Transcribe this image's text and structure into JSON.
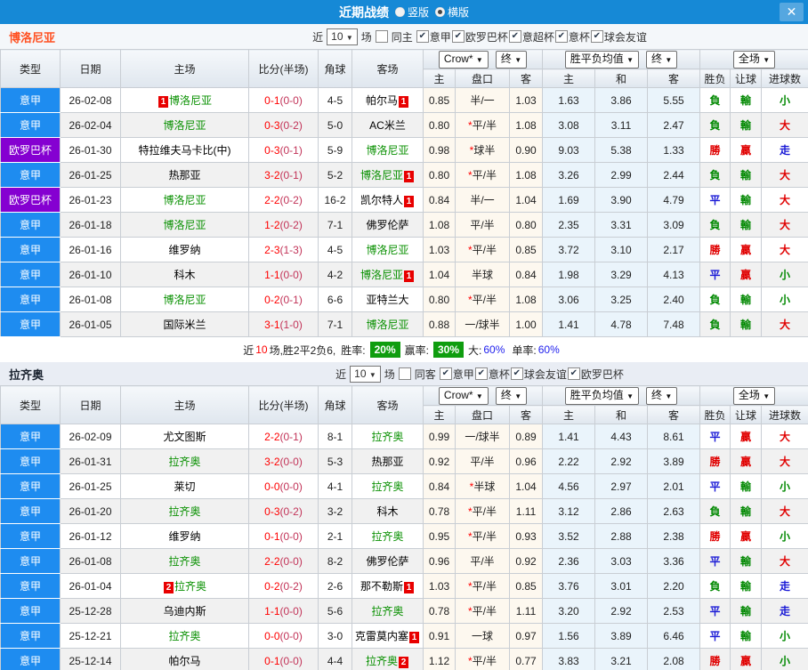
{
  "titlebar": {
    "title": "近期战绩",
    "radio_options": [
      {
        "label": "竖版",
        "selected": false
      },
      {
        "label": "横版",
        "selected": true
      }
    ],
    "close_icon": "✕"
  },
  "icons": {
    "dropdown_arrow": "▼",
    "check": "✔"
  },
  "table_headers": {
    "type": "类型",
    "date": "日期",
    "home": "主场",
    "score": "比分(半场)",
    "corner": "角球",
    "away": "客场",
    "odds_home": "主",
    "odds_line": "盘口",
    "odds_away": "客",
    "avg_home": "主",
    "avg_draw": "和",
    "avg_away": "客",
    "result_wdl": "胜负",
    "result_handicap": "让球",
    "result_goals": "进球数",
    "dropdown_bookmaker": "Crow*",
    "dropdown_final1": "终",
    "dropdown_wdl_avg": "胜平负均值",
    "dropdown_final2": "终",
    "dropdown_fulltime": "全场"
  },
  "sections": [
    {
      "team": "博洛尼亚",
      "filter": {
        "near_label": "近",
        "match_count": "10",
        "games_label": "场",
        "same_label": "同主",
        "same_checked": false,
        "leagues": [
          "意甲",
          "欧罗巴杯",
          "意超杯",
          "意杯",
          "球会友谊"
        ]
      },
      "rows": [
        {
          "league": "意甲",
          "date": "26-02-08",
          "home": {
            "name": "博洛尼亚",
            "focal": true,
            "badge_before": "1"
          },
          "score": "0-1",
          "half": "(0-0)",
          "corner": "4-5",
          "away": {
            "name": "帕尔马",
            "badge_after": "1"
          },
          "odds": {
            "home": "0.85",
            "line": "半/一",
            "line_changed": false,
            "away": "1.03"
          },
          "avg": {
            "home": "1.63",
            "draw": "3.86",
            "away": "5.55"
          },
          "result": [
            "負",
            "輸",
            "小"
          ]
        },
        {
          "league": "意甲",
          "date": "26-02-04",
          "home": {
            "name": "博洛尼亚",
            "focal": true
          },
          "score": "0-3",
          "half": "(0-2)",
          "corner": "5-0",
          "away": {
            "name": "AC米兰"
          },
          "odds": {
            "home": "0.80",
            "line": "平/半",
            "line_changed": true,
            "away": "1.08"
          },
          "avg": {
            "home": "3.08",
            "draw": "3.11",
            "away": "2.47"
          },
          "result": [
            "負",
            "輸",
            "大"
          ]
        },
        {
          "league": "欧罗巴杯",
          "date": "26-01-30",
          "home": {
            "name": "特拉维夫马卡比(中)"
          },
          "score": "0-3",
          "half": "(0-1)",
          "corner": "5-9",
          "away": {
            "name": "博洛尼亚",
            "focal": true
          },
          "odds": {
            "home": "0.98",
            "line": "球半",
            "line_changed": true,
            "away": "0.90"
          },
          "avg": {
            "home": "9.03",
            "draw": "5.38",
            "away": "1.33"
          },
          "result": [
            "勝",
            "贏",
            "走"
          ]
        },
        {
          "league": "意甲",
          "date": "26-01-25",
          "home": {
            "name": "热那亚"
          },
          "score": "3-2",
          "half": "(0-1)",
          "corner": "5-2",
          "away": {
            "name": "博洛尼亚",
            "focal": true,
            "badge_after": "1"
          },
          "odds": {
            "home": "0.80",
            "line": "平/半",
            "line_changed": true,
            "away": "1.08"
          },
          "avg": {
            "home": "3.26",
            "draw": "2.99",
            "away": "2.44"
          },
          "result": [
            "負",
            "輸",
            "大"
          ]
        },
        {
          "league": "欧罗巴杯",
          "date": "26-01-23",
          "home": {
            "name": "博洛尼亚",
            "focal": true
          },
          "score": "2-2",
          "half": "(0-2)",
          "corner": "16-2",
          "away": {
            "name": "凯尔特人",
            "badge_after": "1"
          },
          "odds": {
            "home": "0.84",
            "line": "半/一",
            "line_changed": false,
            "away": "1.04"
          },
          "avg": {
            "home": "1.69",
            "draw": "3.90",
            "away": "4.79"
          },
          "result": [
            "平",
            "輸",
            "大"
          ]
        },
        {
          "league": "意甲",
          "date": "26-01-18",
          "home": {
            "name": "博洛尼亚",
            "focal": true
          },
          "score": "1-2",
          "half": "(0-2)",
          "corner": "7-1",
          "away": {
            "name": "佛罗伦萨"
          },
          "odds": {
            "home": "1.08",
            "line": "平/半",
            "line_changed": false,
            "away": "0.80"
          },
          "avg": {
            "home": "2.35",
            "draw": "3.31",
            "away": "3.09"
          },
          "result": [
            "負",
            "輸",
            "大"
          ]
        },
        {
          "league": "意甲",
          "date": "26-01-16",
          "home": {
            "name": "维罗纳"
          },
          "score": "2-3",
          "half": "(1-3)",
          "corner": "4-5",
          "away": {
            "name": "博洛尼亚",
            "focal": true
          },
          "odds": {
            "home": "1.03",
            "line": "平/半",
            "line_changed": true,
            "away": "0.85"
          },
          "avg": {
            "home": "3.72",
            "draw": "3.10",
            "away": "2.17"
          },
          "result": [
            "勝",
            "贏",
            "大"
          ]
        },
        {
          "league": "意甲",
          "date": "26-01-10",
          "home": {
            "name": "科木"
          },
          "score": "1-1",
          "half": "(0-0)",
          "corner": "4-2",
          "away": {
            "name": "博洛尼亚",
            "focal": true,
            "badge_after": "1"
          },
          "odds": {
            "home": "1.04",
            "line": "半球",
            "line_changed": false,
            "away": "0.84"
          },
          "avg": {
            "home": "1.98",
            "draw": "3.29",
            "away": "4.13"
          },
          "result": [
            "平",
            "贏",
            "小"
          ]
        },
        {
          "league": "意甲",
          "date": "26-01-08",
          "home": {
            "name": "博洛尼亚",
            "focal": true
          },
          "score": "0-2",
          "half": "(0-1)",
          "corner": "6-6",
          "away": {
            "name": "亚特兰大"
          },
          "odds": {
            "home": "0.80",
            "line": "平/半",
            "line_changed": true,
            "away": "1.08"
          },
          "avg": {
            "home": "3.06",
            "draw": "3.25",
            "away": "2.40"
          },
          "result": [
            "負",
            "輸",
            "小"
          ]
        },
        {
          "league": "意甲",
          "date": "26-01-05",
          "home": {
            "name": "国际米兰"
          },
          "score": "3-1",
          "half": "(1-0)",
          "corner": "7-1",
          "away": {
            "name": "博洛尼亚",
            "focal": true
          },
          "odds": {
            "home": "0.88",
            "line": "一/球半",
            "line_changed": false,
            "away": "1.00"
          },
          "avg": {
            "home": "1.41",
            "draw": "4.78",
            "away": "7.48"
          },
          "result": [
            "負",
            "輸",
            "大"
          ]
        }
      ],
      "stats": {
        "near_label": "近",
        "count": "10",
        "record": "场,胜2平2负6,",
        "win_rate_label": "胜率:",
        "win_rate": "20%",
        "profit_rate_label": "赢率:",
        "profit_rate": "30%",
        "big_label": "大:",
        "big_rate": "60%",
        "single_label": "单率:",
        "single_rate": "60%"
      }
    },
    {
      "team": "拉齐奥",
      "filter": {
        "near_label": "近",
        "match_count": "10",
        "games_label": "场",
        "same_label": "同客",
        "same_checked": false,
        "leagues": [
          "意甲",
          "意杯",
          "球会友谊",
          "欧罗巴杯"
        ]
      },
      "rows": [
        {
          "league": "意甲",
          "date": "26-02-09",
          "home": {
            "name": "尤文图斯"
          },
          "score": "2-2",
          "half": "(0-1)",
          "corner": "8-1",
          "away": {
            "name": "拉齐奥",
            "focal": true
          },
          "odds": {
            "home": "0.99",
            "line": "一/球半",
            "line_changed": false,
            "away": "0.89"
          },
          "avg": {
            "home": "1.41",
            "draw": "4.43",
            "away": "8.61"
          },
          "result": [
            "平",
            "贏",
            "大"
          ]
        },
        {
          "league": "意甲",
          "date": "26-01-31",
          "home": {
            "name": "拉齐奥",
            "focal": true
          },
          "score": "3-2",
          "half": "(0-0)",
          "corner": "5-3",
          "away": {
            "name": "热那亚"
          },
          "odds": {
            "home": "0.92",
            "line": "平/半",
            "line_changed": false,
            "away": "0.96"
          },
          "avg": {
            "home": "2.22",
            "draw": "2.92",
            "away": "3.89"
          },
          "result": [
            "勝",
            "贏",
            "大"
          ]
        },
        {
          "league": "意甲",
          "date": "26-01-25",
          "home": {
            "name": "莱切"
          },
          "score": "0-0",
          "half": "(0-0)",
          "corner": "4-1",
          "away": {
            "name": "拉齐奥",
            "focal": true
          },
          "odds": {
            "home": "0.84",
            "line": "半球",
            "line_changed": true,
            "away": "1.04"
          },
          "avg": {
            "home": "4.56",
            "draw": "2.97",
            "away": "2.01"
          },
          "result": [
            "平",
            "輸",
            "小"
          ]
        },
        {
          "league": "意甲",
          "date": "26-01-20",
          "home": {
            "name": "拉齐奥",
            "focal": true
          },
          "score": "0-3",
          "half": "(0-2)",
          "corner": "3-2",
          "away": {
            "name": "科木"
          },
          "odds": {
            "home": "0.78",
            "line": "平/半",
            "line_changed": true,
            "away": "1.11"
          },
          "avg": {
            "home": "3.12",
            "draw": "2.86",
            "away": "2.63"
          },
          "result": [
            "負",
            "輸",
            "大"
          ]
        },
        {
          "league": "意甲",
          "date": "26-01-12",
          "home": {
            "name": "维罗纳"
          },
          "score": "0-1",
          "half": "(0-0)",
          "corner": "2-1",
          "away": {
            "name": "拉齐奥",
            "focal": true
          },
          "odds": {
            "home": "0.95",
            "line": "平/半",
            "line_changed": true,
            "away": "0.93"
          },
          "avg": {
            "home": "3.52",
            "draw": "2.88",
            "away": "2.38"
          },
          "result": [
            "勝",
            "贏",
            "小"
          ]
        },
        {
          "league": "意甲",
          "date": "26-01-08",
          "home": {
            "name": "拉齐奥",
            "focal": true
          },
          "score": "2-2",
          "half": "(0-0)",
          "corner": "8-2",
          "away": {
            "name": "佛罗伦萨"
          },
          "odds": {
            "home": "0.96",
            "line": "平/半",
            "line_changed": false,
            "away": "0.92"
          },
          "avg": {
            "home": "2.36",
            "draw": "3.03",
            "away": "3.36"
          },
          "result": [
            "平",
            "輸",
            "大"
          ]
        },
        {
          "league": "意甲",
          "date": "26-01-04",
          "home": {
            "name": "拉齐奥",
            "focal": true,
            "badge_before": "2"
          },
          "score": "0-2",
          "half": "(0-2)",
          "corner": "2-6",
          "away": {
            "name": "那不勒斯",
            "badge_after": "1"
          },
          "odds": {
            "home": "1.03",
            "line": "平/半",
            "line_changed": true,
            "away": "0.85"
          },
          "avg": {
            "home": "3.76",
            "draw": "3.01",
            "away": "2.20"
          },
          "result": [
            "負",
            "輸",
            "走"
          ]
        },
        {
          "league": "意甲",
          "date": "25-12-28",
          "home": {
            "name": "乌迪内斯"
          },
          "score": "1-1",
          "half": "(0-0)",
          "corner": "5-6",
          "away": {
            "name": "拉齐奥",
            "focal": true
          },
          "odds": {
            "home": "0.78",
            "line": "平/半",
            "line_changed": true,
            "away": "1.11"
          },
          "avg": {
            "home": "3.20",
            "draw": "2.92",
            "away": "2.53"
          },
          "result": [
            "平",
            "輸",
            "走"
          ]
        },
        {
          "league": "意甲",
          "date": "25-12-21",
          "home": {
            "name": "拉齐奥",
            "focal": true
          },
          "score": "0-0",
          "half": "(0-0)",
          "corner": "3-0",
          "away": {
            "name": "克雷莫内塞",
            "badge_after": "1"
          },
          "odds": {
            "home": "0.91",
            "line": "一球",
            "line_changed": false,
            "away": "0.97"
          },
          "avg": {
            "home": "1.56",
            "draw": "3.89",
            "away": "6.46"
          },
          "result": [
            "平",
            "輸",
            "小"
          ]
        },
        {
          "league": "意甲",
          "date": "25-12-14",
          "home": {
            "name": "帕尔马"
          },
          "score": "0-1",
          "half": "(0-0)",
          "corner": "4-4",
          "away": {
            "name": "拉齐奥",
            "focal": true,
            "badge_after": "2"
          },
          "odds": {
            "home": "1.12",
            "line": "平/半",
            "line_changed": true,
            "away": "0.77"
          },
          "avg": {
            "home": "3.83",
            "draw": "3.21",
            "away": "2.08"
          },
          "result": [
            "勝",
            "贏",
            "小"
          ]
        }
      ]
    }
  ]
}
